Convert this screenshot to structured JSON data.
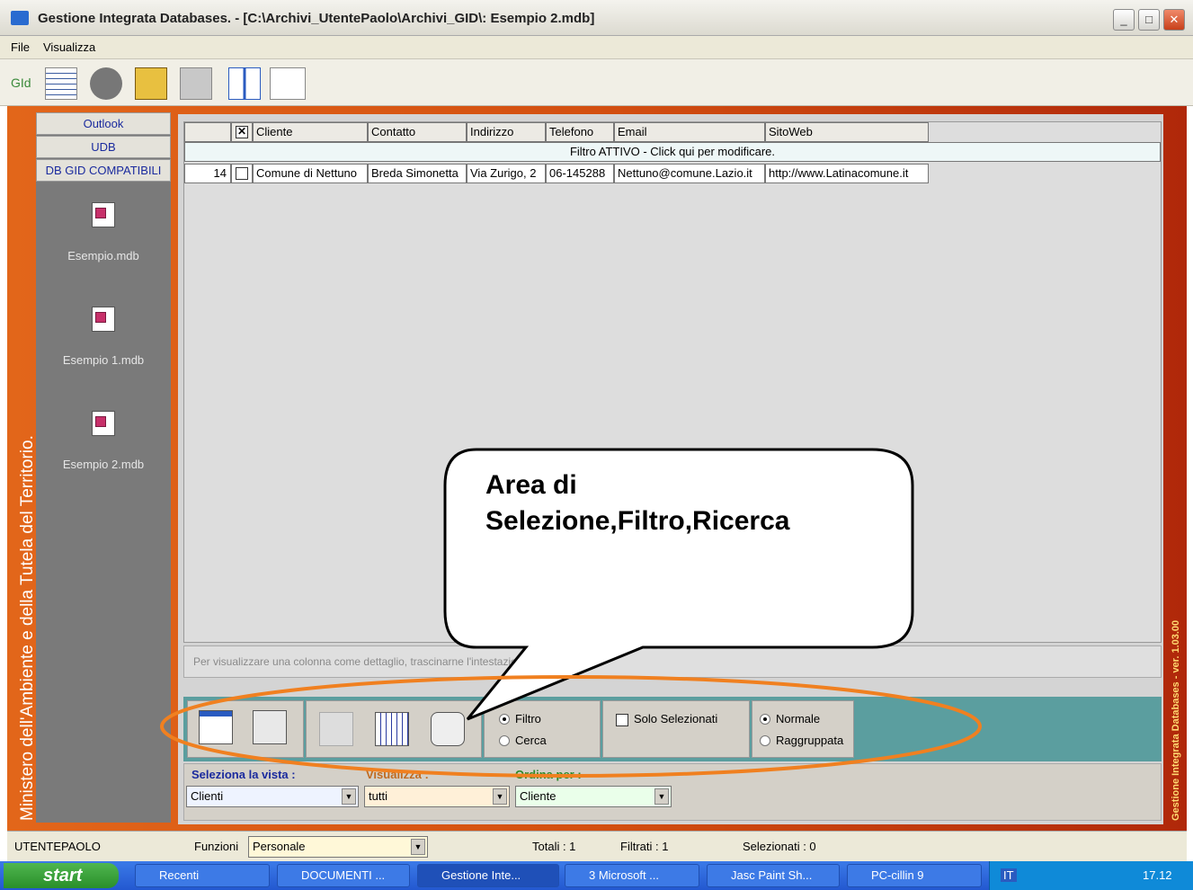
{
  "window": {
    "title": "Gestione Integrata Databases. - [C:\\Archivi_UtentePaolo\\Archivi_GID\\: Esempio 2.mdb]",
    "min": "_",
    "restore": "□",
    "close": "✕"
  },
  "menu": {
    "file": "File",
    "view": "Visualizza"
  },
  "toolbar": {
    "gid_label": "GId",
    "icons": [
      "table-icon",
      "globe-icon",
      "lock-icon",
      "database-icon",
      "columns-icon",
      "print-icon"
    ]
  },
  "side_text": "Ministero dell'Ambiente e della Tutela del Territorio.",
  "right_text": "Gestione Integrata Databases - ver. 1.03.00",
  "sidebar": {
    "buttons": [
      "Outlook",
      "UDB",
      "DB GID COMPATIBILI"
    ],
    "dbs": [
      "Esempio.mdb",
      "Esempio 1.mdb",
      "Esempio 2.mdb"
    ]
  },
  "grid": {
    "columns": [
      "Cliente",
      "Contatto",
      "Indirizzo",
      "Telefono",
      "Email",
      "SitoWeb"
    ],
    "filter_notice": "Filtro ATTIVO - Click qui per modificare.",
    "rows": [
      {
        "id": "14",
        "cells": [
          "Comune di Nettuno",
          "Breda Simonetta",
          "Via Zurigo, 2",
          "06-145288",
          "Nettuno@comune.Lazio.it",
          "http://www.Latinacomune.it"
        ]
      }
    ]
  },
  "hint": "Per visualizzare una colonna come dettaglio, trascinarne l'intestazione in quest'area.",
  "callout": "Area di Selezione,Filtro,Ricerca",
  "options": {
    "filtro": "Filtro",
    "cerca": "Cerca",
    "solo_selezionati": "Solo Selezionati",
    "normale": "Normale",
    "raggruppata": "Raggruppata"
  },
  "selectors": {
    "vista_label": "Seleziona la vista :",
    "vista_value": "Clienti",
    "vis_label": "Visualizza :",
    "vis_value": "tutti",
    "ordina_label": "Ordina per :",
    "ordina_value": "Cliente"
  },
  "status": {
    "user": "UTENTEPAOLO",
    "funzioni_label": "Funzioni",
    "funzioni_value": "Personale",
    "totali": "Totali :   1",
    "filtrati": "Filtrati :   1",
    "selezionati": "Selezionati :  0"
  },
  "taskbar": {
    "start": "start",
    "items": [
      "Recenti",
      "DOCUMENTI ...",
      "Gestione Inte...",
      "3 Microsoft ...",
      "Jasc Paint Sh...",
      "PC-cillin 9"
    ],
    "lang": "IT",
    "clock": "17.12"
  }
}
